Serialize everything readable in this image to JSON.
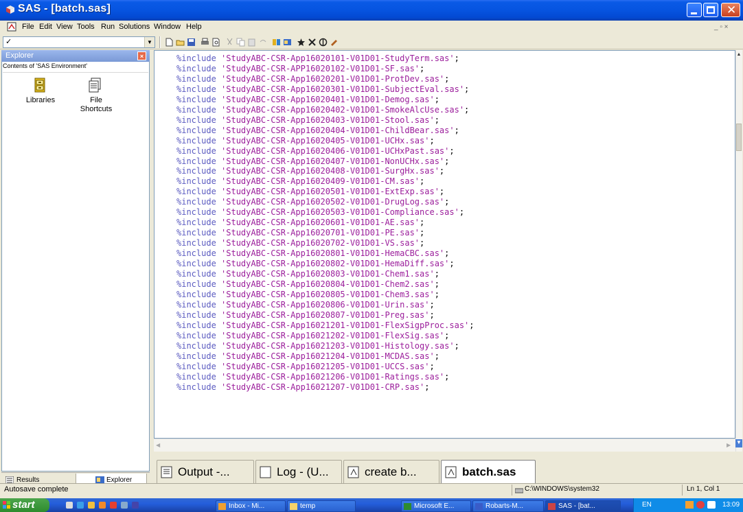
{
  "window": {
    "title": "SAS - [batch.sas]"
  },
  "menu": [
    "File",
    "Edit",
    "View",
    "Tools",
    "Run",
    "Solutions",
    "Window",
    "Help"
  ],
  "command_box": {
    "value": "✓"
  },
  "explorer": {
    "title": "Explorer",
    "contents_label": "Contents of 'SAS Environment'",
    "items": [
      {
        "label": "Libraries",
        "icon": "library-drawer-icon"
      },
      {
        "label": "File Shortcuts",
        "icon": "file-shortcuts-icon"
      }
    ]
  },
  "left_tabs": [
    {
      "label": "Results",
      "icon": "results-icon"
    },
    {
      "label": "Explorer",
      "icon": "explorer-icon"
    }
  ],
  "editor": {
    "keyword": "%include",
    "lines": [
      "'StudyABC-CSR-App16020101-V01D01-StudyTerm.sas'",
      "'StudyABC-CSR-APP16020102-V01D01-SF.sas'",
      "'StudyABC-CSR-App16020201-V01D01-ProtDev.sas'",
      "'StudyABC-CSR-App16020301-V01D01-SubjectEval.sas'",
      "'StudyABC-CSR-App16020401-V01D01-Demog.sas'",
      "'StudyABC-CSR-App16020402-V01D01-SmokeAlcUse.sas'",
      "'StudyABC-CSR-App16020403-V01D01-Stool.sas'",
      "'StudyABC-CSR-App16020404-V01D01-ChildBear.sas'",
      "'StudyABC-CSR-App16020405-V01D01-UCHx.sas'",
      "'StudyABC-CSR-App16020406-V01D01-UCHxPast.sas'",
      "'StudyABC-CSR-App16020407-V01D01-NonUCHx.sas'",
      "'StudyABC-CSR-App16020408-V01D01-SurgHx.sas'",
      "'StudyABC-CSR-App16020409-V01D01-CM.sas'",
      "'StudyABC-CSR-App16020501-V01D01-ExtExp.sas'",
      "'StudyABC-CSR-App16020502-V01D01-DrugLog.sas'",
      "'StudyABC-CSR-App16020503-V01D01-Compliance.sas'",
      "'StudyABC-CSR-App16020601-V01D01-AE.sas'",
      "'StudyABC-CSR-App16020701-V01D01-PE.sas'",
      "'StudyABC-CSR-App16020702-V01D01-VS.sas'",
      "'StudyABC-CSR-App16020801-V01D01-HemaCBC.sas'",
      "'StudyABC-CSR-App16020802-V01D01-HemaDiff.sas'",
      "'StudyABC-CSR-App16020803-V01D01-Chem1.sas'",
      "'StudyABC-CSR-App16020804-V01D01-Chem2.sas'",
      "'StudyABC-CSR-App16020805-V01D01-Chem3.sas'",
      "'StudyABC-CSR-App16020806-V01D01-Urin.sas'",
      "'StudyABC-CSR-App16020807-V01D01-Preg.sas'",
      "'StudyABC-CSR-App16021201-V01D01-FlexSigpProc.sas'",
      "'StudyABC-CSR-App16021202-V01D01-FlexSig.sas'",
      "'StudyABC-CSR-App16021203-V01D01-Histology.sas'",
      "'StudyABC-CSR-App16021204-V01D01-MCDAS.sas'",
      "'StudyABC-CSR-App16021205-V01D01-UCCS.sas'",
      "'StudyABC-CSR-App16021206-V01D01-Ratings.sas'",
      "'StudyABC-CSR-App16021207-V01D01-CRP.sas'"
    ]
  },
  "window_tabs": [
    {
      "label": "Output -...",
      "icon": "output-window-icon"
    },
    {
      "label": "Log - (U...",
      "icon": "log-window-icon"
    },
    {
      "label": "create b...",
      "icon": "program-editor-icon"
    },
    {
      "label": "batch.sas",
      "icon": "program-editor-icon",
      "active": true
    }
  ],
  "status": {
    "message": "Autosave complete",
    "path": "C:\\WINDOWS\\system32",
    "position": "Ln 1, Col 1"
  },
  "taskbar": {
    "start_label": "start",
    "tasks": [
      {
        "label": "Inbox - Mi...",
        "icon": "outlook-icon"
      },
      {
        "label": "temp",
        "icon": "folder-icon"
      },
      {
        "label": "Microsoft E...",
        "icon": "excel-icon"
      },
      {
        "label": "Robarts-M...",
        "icon": "word-icon"
      },
      {
        "label": "SAS - [bat...",
        "icon": "sas-icon"
      }
    ],
    "language": "EN",
    "clock": "13:09"
  },
  "colors": {
    "titlebar": "#0654e0",
    "keyword": "#5a5ac0",
    "string": "#9b1d9b",
    "taskbar": "#245edb",
    "start": "#2e8b2e"
  }
}
